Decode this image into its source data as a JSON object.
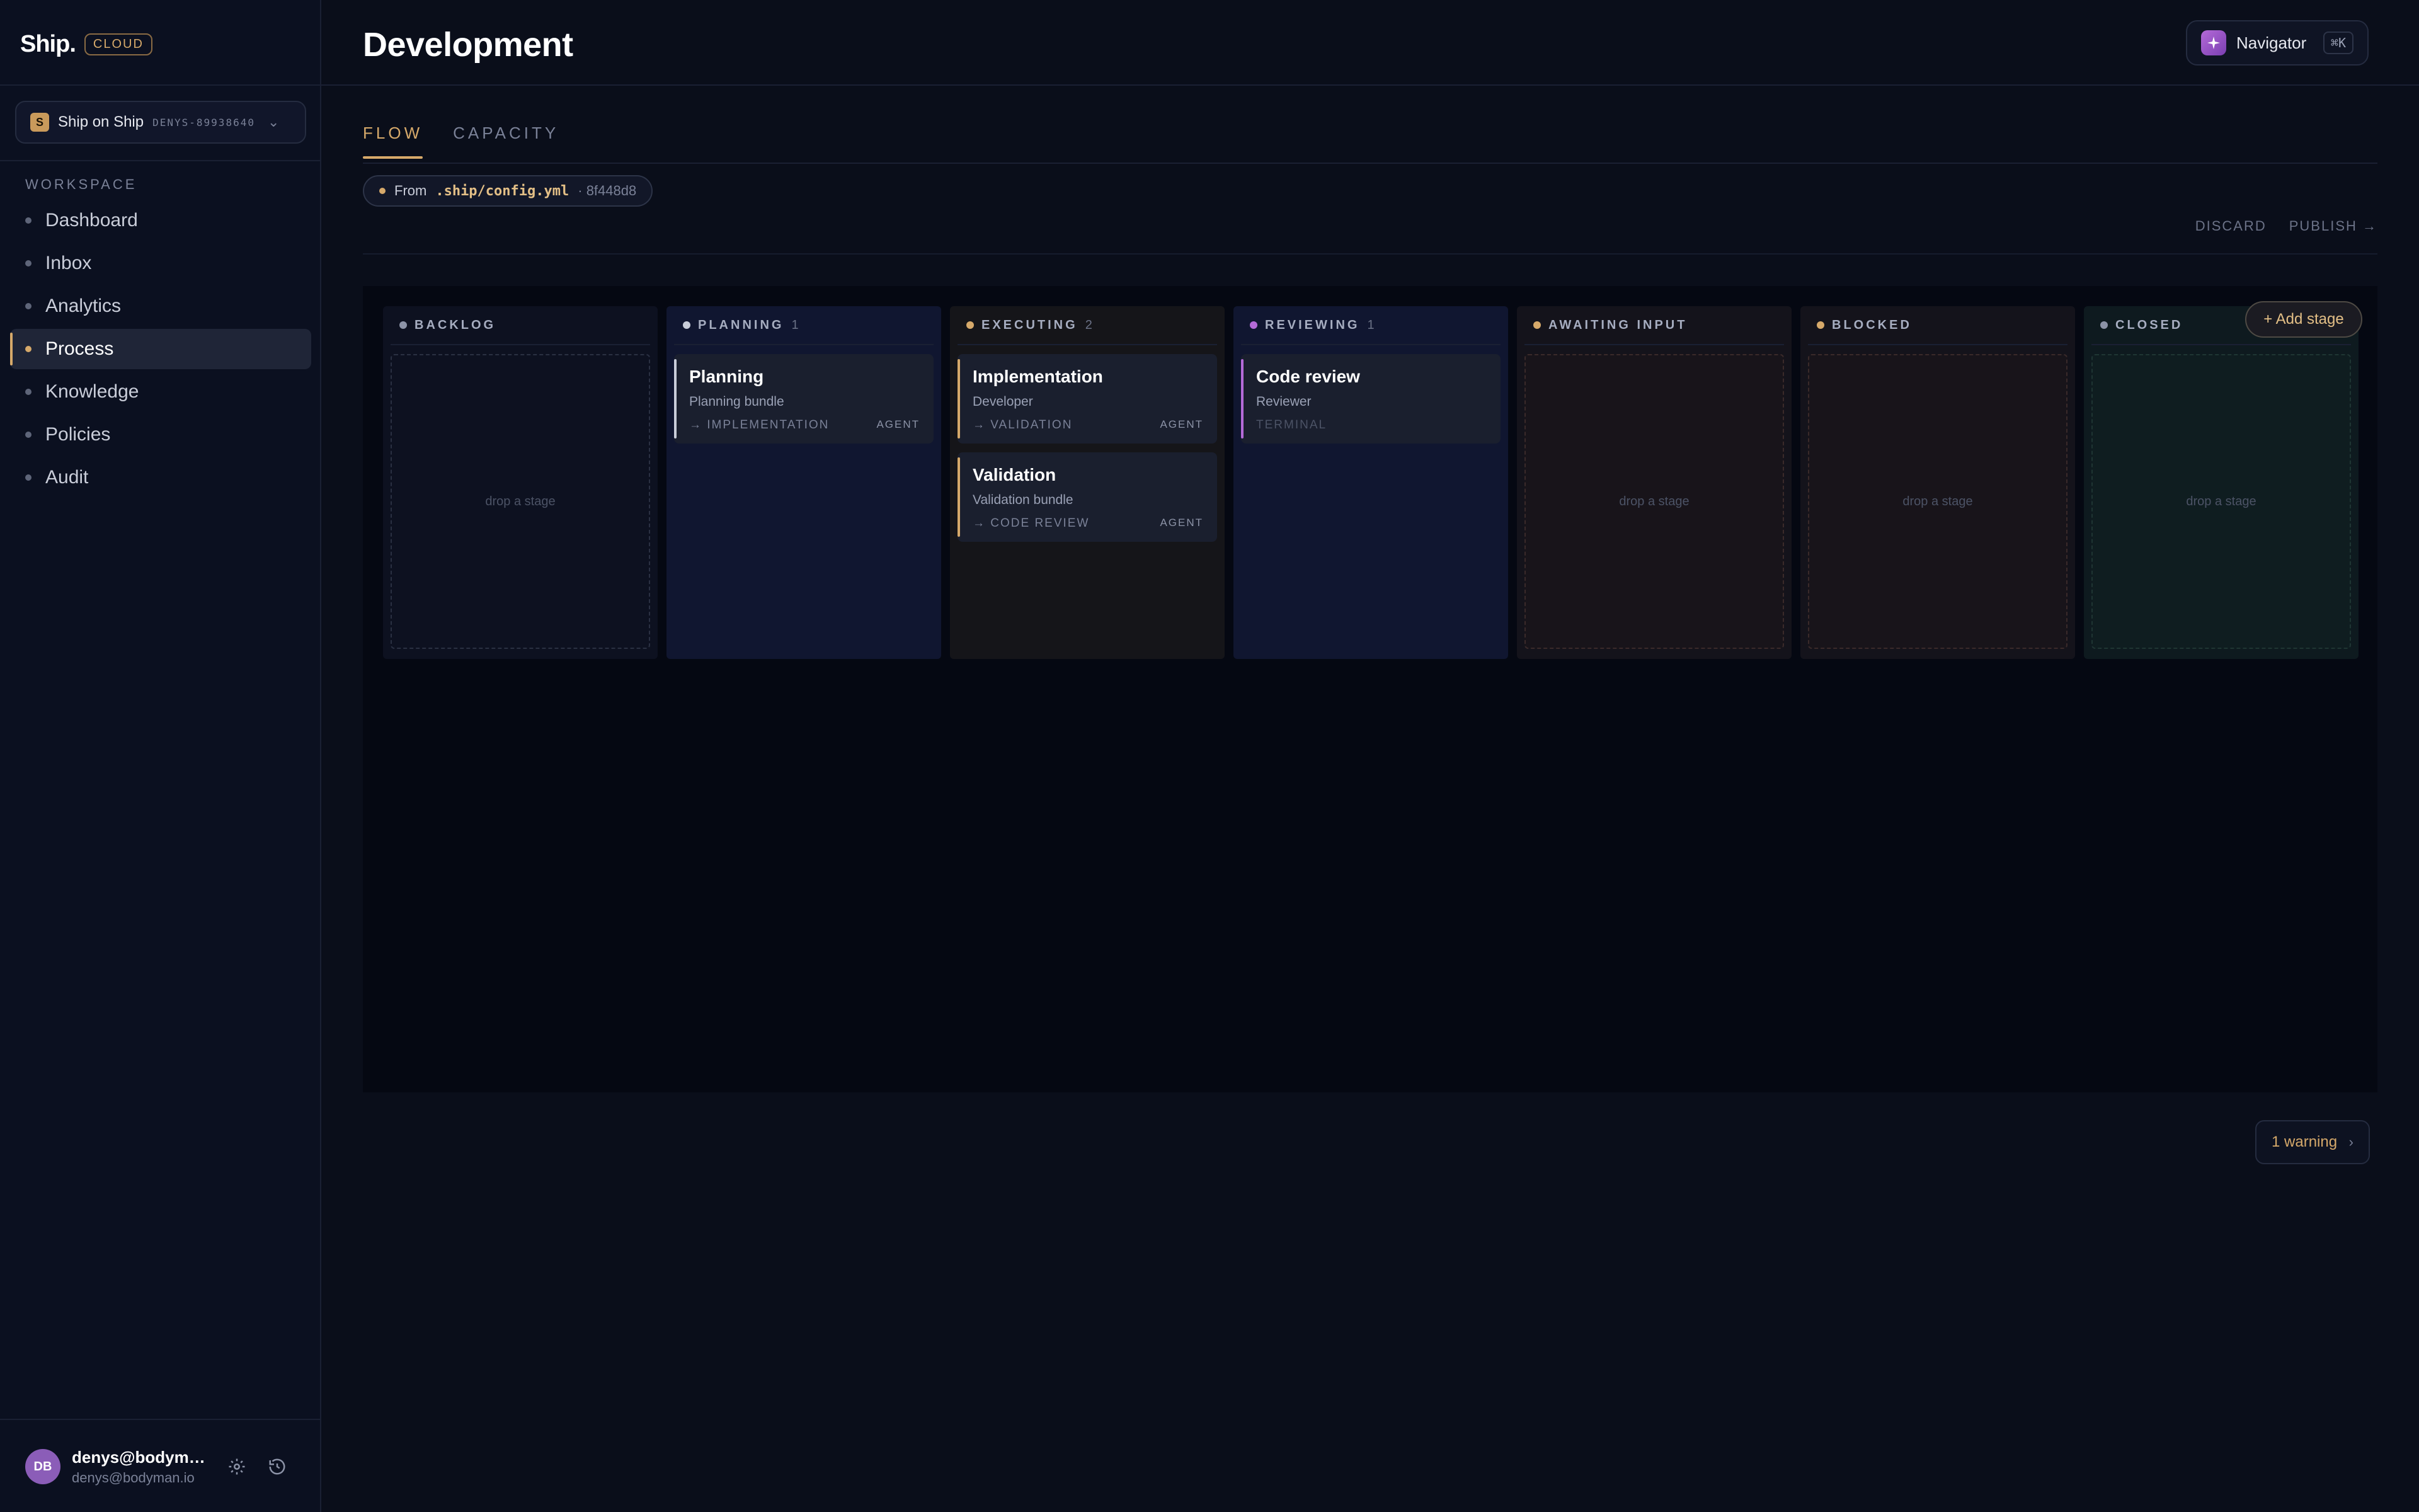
{
  "sidebar": {
    "brand": "Ship.",
    "badge": "CLOUD",
    "project": {
      "logo": "S",
      "name": "Ship on Ship",
      "id": "DENYS-89938640"
    },
    "section_label": "WORKSPACE",
    "items": [
      {
        "label": "Dashboard"
      },
      {
        "label": "Inbox"
      },
      {
        "label": "Analytics"
      },
      {
        "label": "Process"
      },
      {
        "label": "Knowledge"
      },
      {
        "label": "Policies"
      },
      {
        "label": "Audit"
      }
    ],
    "active_item": "Process",
    "user": {
      "initials": "DB",
      "name": "denys@bodyma…",
      "email": "denys@bodyman.io"
    }
  },
  "header": {
    "title": "Development",
    "navigator": {
      "label": "Navigator",
      "shortcut": "⌘K"
    }
  },
  "tabs": [
    {
      "label": "FLOW"
    },
    {
      "label": "CAPACITY"
    }
  ],
  "active_tab": "FLOW",
  "source": {
    "from_label": "From",
    "path": ".ship/config.yml",
    "hash": "· 8f448d8"
  },
  "actions": {
    "discard": "DISCARD",
    "publish": "PUBLISH →"
  },
  "add_stage_label": "+ Add stage",
  "columns": [
    {
      "title": "BACKLOG",
      "count": "",
      "dot": "#8c93a7",
      "bg": "#0d1120",
      "empty": "drop a stage"
    },
    {
      "title": "PLANNING",
      "count": "1",
      "dot": "#c9cdd9",
      "bg": "#101630"
    },
    {
      "title": "EXECUTING",
      "count": "2",
      "dot": "#d6a96a",
      "bg": "#151519"
    },
    {
      "title": "REVIEWING",
      "count": "1",
      "dot": "#b46ad8",
      "bg": "#101630"
    },
    {
      "title": "AWAITING INPUT",
      "count": "",
      "dot": "#d6a96a",
      "bg": "#14131b",
      "empty": "drop a stage"
    },
    {
      "title": "BLOCKED",
      "count": "",
      "dot": "#d6a96a",
      "bg": "#14131b",
      "empty": "drop a stage"
    },
    {
      "title": "CLOSED",
      "count": "",
      "dot": "#8c93a7",
      "bg": "#0e1a1f",
      "empty": "drop a stage"
    }
  ],
  "cards": {
    "planning": {
      "title": "Planning",
      "sub": "Planning bundle",
      "next": "→ IMPLEMENTATION",
      "role": "AGENT",
      "accent": "#c9cdd9"
    },
    "implementation": {
      "title": "Implementation",
      "sub": "Developer",
      "next": "→ VALIDATION",
      "role": "AGENT",
      "accent": "#d6a96a"
    },
    "validation": {
      "title": "Validation",
      "sub": "Validation bundle",
      "next": "→ CODE REVIEW",
      "role": "AGENT",
      "accent": "#d6a96a"
    },
    "code_review": {
      "title": "Code review",
      "sub": "Reviewer",
      "next": "TERMINAL",
      "role": "",
      "accent": "#b46ad8"
    }
  },
  "warning": {
    "label": "1 warning",
    "arrow": "›"
  },
  "icons": {
    "settings": "gear-icon",
    "history": "history-icon",
    "navigator": "sparkle-icon",
    "chevron": "chevron-down-icon"
  }
}
